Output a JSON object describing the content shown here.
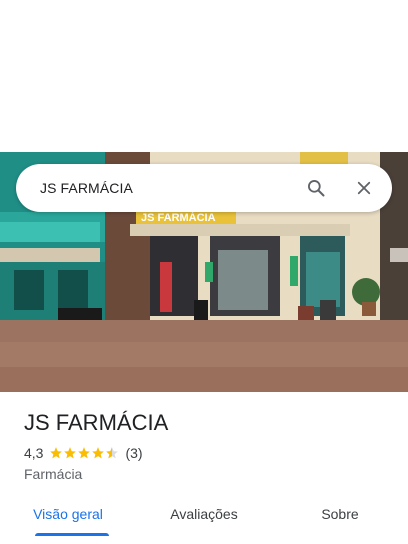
{
  "search": {
    "query": "JS FARMÁCIA"
  },
  "photo": {
    "sign_text": "JS FARMÁCIA"
  },
  "place": {
    "name": "JS FARMÁCIA",
    "rating": "4,3",
    "rating_value": 4.3,
    "review_count": "(3)",
    "category": "Farmácia"
  },
  "tabs": [
    {
      "label": "Visão geral",
      "active": true
    },
    {
      "label": "Avaliações",
      "active": false
    },
    {
      "label": "Sobre",
      "active": false
    }
  ],
  "colors": {
    "accent": "#1a73e8",
    "star": "#fbbc04"
  }
}
